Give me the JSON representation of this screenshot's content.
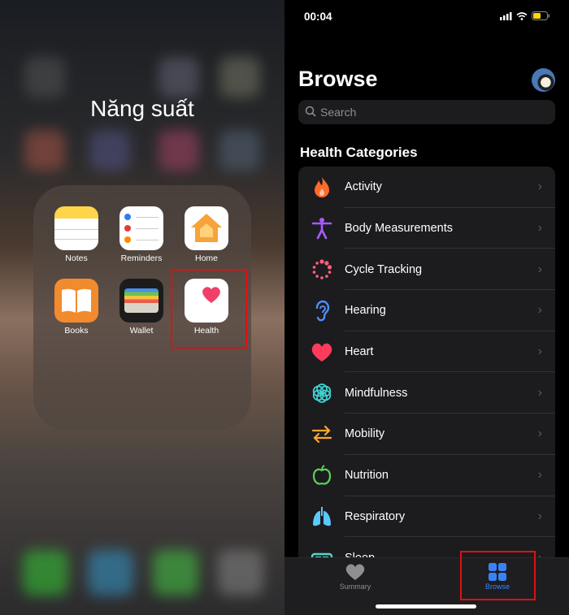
{
  "home_screen": {
    "folder_title": "Năng suất",
    "apps": [
      {
        "label": "Notes",
        "icon": "notes-icon"
      },
      {
        "label": "Reminders",
        "icon": "reminders-icon"
      },
      {
        "label": "Home",
        "icon": "home-icon"
      },
      {
        "label": "Books",
        "icon": "books-icon"
      },
      {
        "label": "Wallet",
        "icon": "wallet-icon"
      },
      {
        "label": "Health",
        "icon": "health-heart-icon"
      }
    ],
    "highlight_color": "#e01010"
  },
  "health_app": {
    "status_time": "00:04",
    "title": "Browse",
    "search_placeholder": "Search",
    "section_title": "Health Categories",
    "categories": [
      {
        "label": "Activity",
        "icon": "flame-icon",
        "color": "#ff6a2b"
      },
      {
        "label": "Body Measurements",
        "icon": "person-figure-icon",
        "color": "#a65bff"
      },
      {
        "label": "Cycle Tracking",
        "icon": "cycle-dots-icon",
        "color": "#ff5f7e"
      },
      {
        "label": "Hearing",
        "icon": "ear-icon",
        "color": "#4f8dfb"
      },
      {
        "label": "Heart",
        "icon": "heart-icon",
        "color": "#ff3b5c"
      },
      {
        "label": "Mindfulness",
        "icon": "flower-icon",
        "color": "#40d0d0"
      },
      {
        "label": "Mobility",
        "icon": "arrows-icon",
        "color": "#ffa62b"
      },
      {
        "label": "Nutrition",
        "icon": "apple-icon",
        "color": "#5bd35b"
      },
      {
        "label": "Respiratory",
        "icon": "lungs-icon",
        "color": "#5ac8fa"
      },
      {
        "label": "Sleep",
        "icon": "bed-icon",
        "color": "#5ad3c8"
      }
    ],
    "tabs": [
      {
        "label": "Summary",
        "icon": "heart-icon",
        "active": false
      },
      {
        "label": "Browse",
        "icon": "grid-icon",
        "active": true
      }
    ],
    "accent": "#3b82f6"
  }
}
